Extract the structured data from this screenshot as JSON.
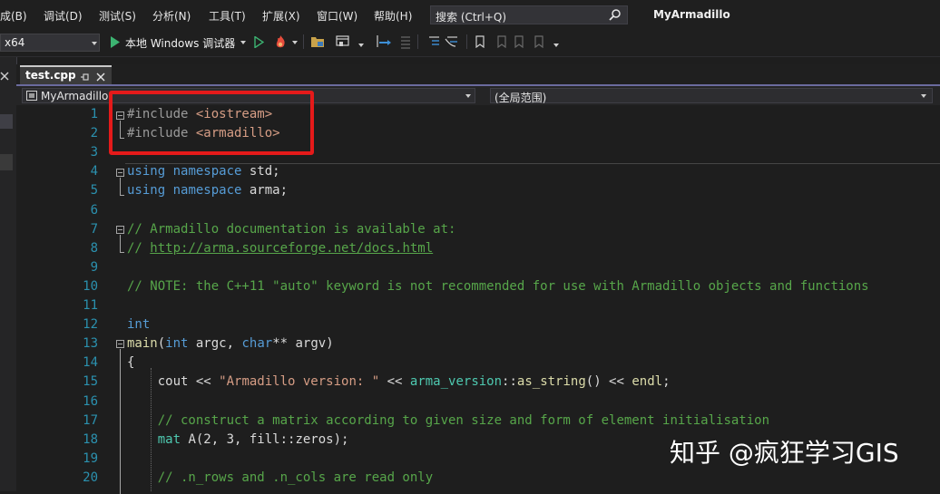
{
  "menu": {
    "items": [
      "成(B)",
      "调试(D)",
      "测试(S)",
      "分析(N)",
      "工具(T)",
      "扩展(X)",
      "窗口(W)",
      "帮助(H)"
    ]
  },
  "search": {
    "placeholder": "搜索 (Ctrl+Q)"
  },
  "app_title": "MyArmadillo",
  "toolbar": {
    "platform": "x64",
    "run_label": "本地 Windows 调试器"
  },
  "tab": {
    "label": "test.cpp"
  },
  "navbar": {
    "project": "MyArmadillo",
    "scope": "(全局范围)"
  },
  "code": {
    "lines": [
      {
        "n": "1",
        "tokens": [
          [
            "pp",
            "#include "
          ],
          [
            "inc",
            "<iostream>"
          ]
        ]
      },
      {
        "n": "2",
        "tokens": [
          [
            "pp",
            "#include "
          ],
          [
            "inc",
            "<armadillo>"
          ]
        ]
      },
      {
        "n": "3",
        "tokens": []
      },
      {
        "n": "4",
        "tokens": [
          [
            "kw",
            "using"
          ],
          [
            "id",
            " "
          ],
          [
            "kw",
            "namespace"
          ],
          [
            "id",
            " std;"
          ]
        ]
      },
      {
        "n": "5",
        "tokens": [
          [
            "kw",
            "using"
          ],
          [
            "id",
            " "
          ],
          [
            "kw",
            "namespace"
          ],
          [
            "id",
            " arma;"
          ]
        ]
      },
      {
        "n": "6",
        "tokens": []
      },
      {
        "n": "7",
        "tokens": [
          [
            "cm",
            "// Armadillo documentation is available at:"
          ]
        ]
      },
      {
        "n": "8",
        "tokens": [
          [
            "cm",
            "// "
          ],
          [
            "link",
            "http://arma.sourceforge.net/docs.html"
          ]
        ]
      },
      {
        "n": "9",
        "tokens": []
      },
      {
        "n": "10",
        "tokens": [
          [
            "cm",
            "// NOTE: the C++11 \"auto\" keyword is not recommended for use with Armadillo objects and functions"
          ]
        ]
      },
      {
        "n": "11",
        "tokens": []
      },
      {
        "n": "12",
        "tokens": [
          [
            "kw",
            "int"
          ]
        ]
      },
      {
        "n": "13",
        "tokens": [
          [
            "fn",
            "main"
          ],
          [
            "id",
            "("
          ],
          [
            "kw",
            "int"
          ],
          [
            "id",
            " argc, "
          ],
          [
            "kw",
            "char"
          ],
          [
            "id",
            "** argv)"
          ]
        ]
      },
      {
        "n": "14",
        "tokens": [
          [
            "id",
            "{"
          ]
        ]
      },
      {
        "n": "15",
        "tokens": [
          [
            "id",
            "    cout << "
          ],
          [
            "str",
            "\"Armadillo version: \""
          ],
          [
            "id",
            " << "
          ],
          [
            "ty",
            "arma_version"
          ],
          [
            "id",
            "::"
          ],
          [
            "fn",
            "as_string"
          ],
          [
            "id",
            "() << "
          ],
          [
            "fn",
            "endl"
          ],
          [
            "id",
            ";"
          ]
        ]
      },
      {
        "n": "16",
        "tokens": []
      },
      {
        "n": "17",
        "tokens": [
          [
            "cm",
            "    // construct a matrix according to given size and form of element initialisation"
          ]
        ]
      },
      {
        "n": "18",
        "tokens": [
          [
            "ty",
            "    mat"
          ],
          [
            "id",
            " A(2, 3, fill::zeros);"
          ]
        ]
      },
      {
        "n": "19",
        "tokens": []
      },
      {
        "n": "20",
        "tokens": [
          [
            "cm",
            "    // .n_rows and .n_cols are read only"
          ]
        ]
      }
    ]
  },
  "watermark": "知乎 @疯狂学习GIS",
  "colors": {
    "background": "#1e1e1e",
    "keyword": "#569cd6",
    "comment": "#57a64a",
    "string": "#d69d85",
    "line_number": "#2b91af",
    "highlight_box": "#e51a1a"
  }
}
